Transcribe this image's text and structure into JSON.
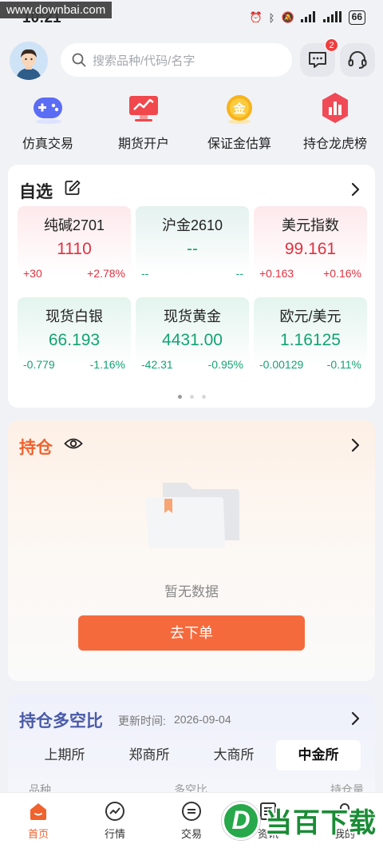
{
  "status_bar": {
    "time": "10:21",
    "battery": "66",
    "watermark": "www.downbai.com"
  },
  "header": {
    "search_placeholder": "搜索品种/代码/名字",
    "message_badge": "2"
  },
  "quick_menu": [
    {
      "label": "仿真交易",
      "icon": "gamepad-icon"
    },
    {
      "label": "期货开户",
      "icon": "chart-monitor-icon"
    },
    {
      "label": "保证金估算",
      "icon": "gold-coin-icon"
    },
    {
      "label": "持仓龙虎榜",
      "icon": "ranking-bar-icon"
    }
  ],
  "watchlist": {
    "title": "自选",
    "tiles": [
      {
        "name": "纯碱2701",
        "price": "1110",
        "change": "+30",
        "pct": "+2.78%",
        "trend": "up"
      },
      {
        "name": "沪金2610",
        "price": "--",
        "change": "--",
        "pct": "--",
        "trend": "flat"
      },
      {
        "name": "美元指数",
        "price": "99.161",
        "change": "+0.163",
        "pct": "+0.16%",
        "trend": "up"
      },
      {
        "name": "现货白银",
        "price": "66.193",
        "change": "-0.779",
        "pct": "-1.16%",
        "trend": "down"
      },
      {
        "name": "现货黄金",
        "price": "4431.00",
        "change": "-42.31",
        "pct": "-0.95%",
        "trend": "down"
      },
      {
        "name": "欧元/美元",
        "price": "1.16125",
        "change": "-0.00129",
        "pct": "-0.11%",
        "trend": "down"
      }
    ],
    "page_count": 3,
    "active_page": 1
  },
  "holdings": {
    "title": "持仓",
    "empty_text": "暂无数据",
    "order_button": "去下单"
  },
  "long_short_ratio": {
    "title": "持仓多空比",
    "update_label": "更新时间:",
    "update_value": "2026-09-04",
    "exchanges": [
      "上期所",
      "郑商所",
      "大商所",
      "中金所"
    ],
    "active_exchange": 3,
    "columns": [
      "品种",
      "多空比",
      "持仓量"
    ]
  },
  "bottom_nav": [
    {
      "label": "首页",
      "active": true
    },
    {
      "label": "行情",
      "active": false
    },
    {
      "label": "交易",
      "active": false
    },
    {
      "label": "资讯",
      "active": false
    },
    {
      "label": "我的",
      "active": false
    }
  ],
  "brand_overlay": {
    "text": "当百下载",
    "logo_letter": "D"
  },
  "colors": {
    "up": "#e0313f",
    "down": "#14a373",
    "accent": "#f56a3d"
  }
}
